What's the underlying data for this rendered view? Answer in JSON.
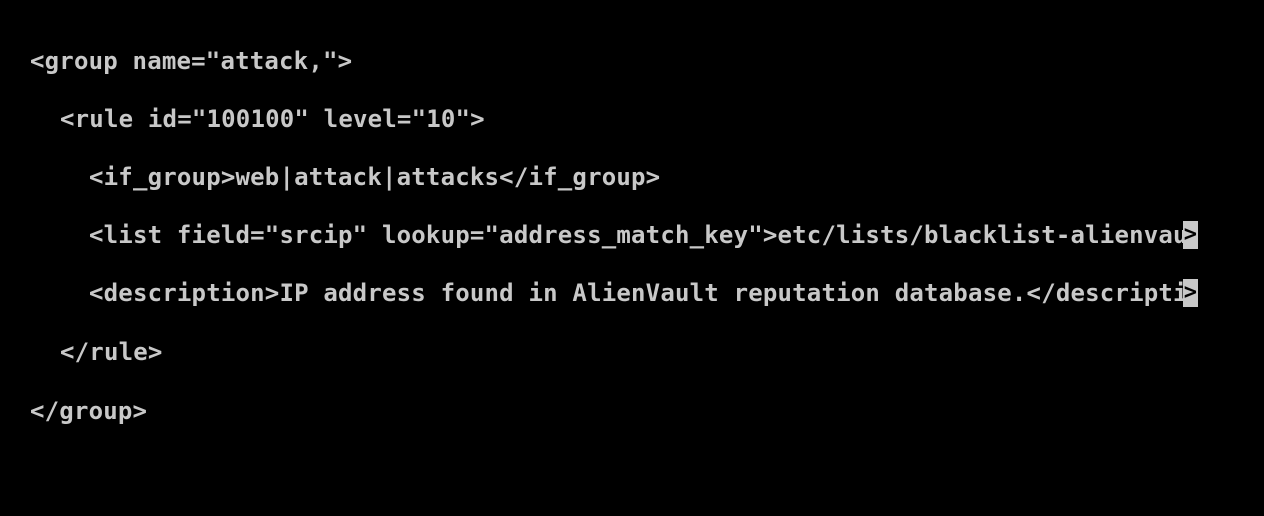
{
  "terminal": {
    "background": "#000000",
    "foreground": "#c8c8c8",
    "lines": [
      "<group name=\"attack,\">",
      "<rule id=\"100100\" level=\"10\">",
      "<if_group>web|attack|attacks</if_group>",
      "<list field=\"srcip\" lookup=\"address_match_key\">etc/lists/blacklist-alienvau",
      "<description>IP address found in AlienVault reputation database.</descripti",
      "</rule>",
      "</group>"
    ],
    "overflow_marker": ">",
    "overflow_marker_icon": "line-overflow-indicator-icon"
  }
}
